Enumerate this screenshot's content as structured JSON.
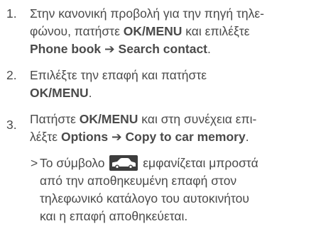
{
  "steps": [
    {
      "number": "1.",
      "line1": "Στην κανονική προβολή για την πηγή τηλε-",
      "line2_a": "φώνου, πατήστε ",
      "line2_b": "OK/MENU",
      "line2_c": " και επιλέξτε",
      "line3_a": "Phone book",
      "line3_arrow": "➔",
      "line3_b": " Search contact",
      "line3_c": "."
    },
    {
      "number": "2.",
      "line1": "Επιλέξτε την επαφή και πατήστε",
      "line2_a": "OK/MENU",
      "line2_b": "."
    },
    {
      "number": "3.",
      "line1_a": "Πατήστε ",
      "line1_b": "OK/MENU",
      "line1_c": " και στη συνέχεια επι-",
      "line2_a": "λέξτε ",
      "line2_b": "Options",
      "line2_arrow": "➔",
      "line2_c": " Copy to car memory",
      "line2_d": ".",
      "result": {
        "marker": ">",
        "line1_a": "Το σύμβολο ",
        "line1_b": " εμφανίζεται μπροστά",
        "line2": "από την αποθηκευμένη επαφή στον",
        "line3": "τηλεφωνικό κατάλογο του αυτοκινήτου",
        "line4": "και η επαφή αποθηκεύεται.",
        "icon": "car-icon"
      }
    }
  ]
}
